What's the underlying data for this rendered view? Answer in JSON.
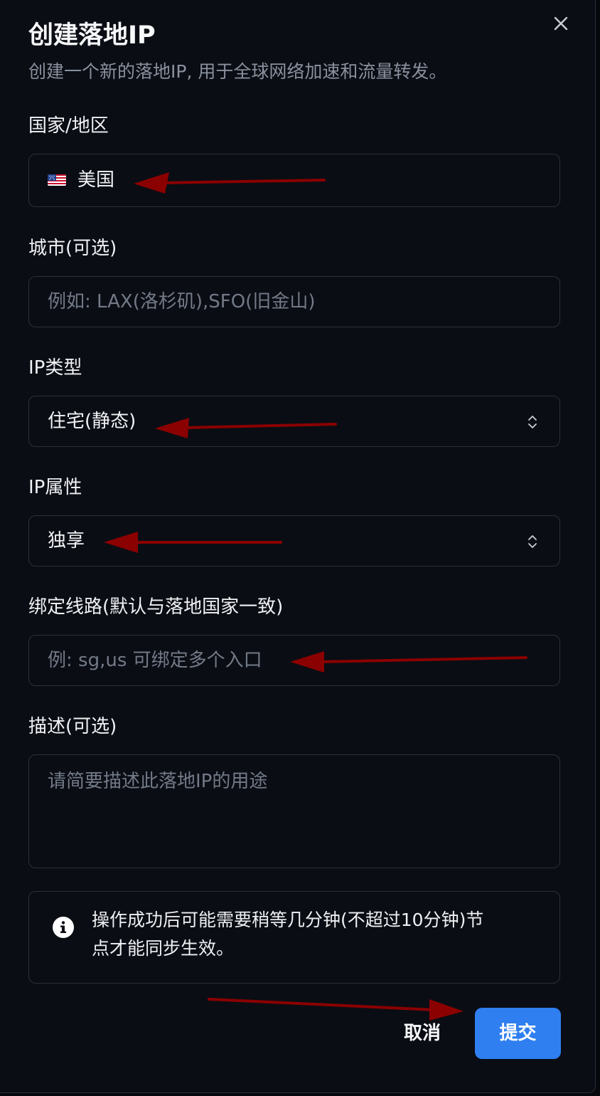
{
  "dialog": {
    "title": "创建落地IP",
    "subtitle": "创建一个新的落地IP, 用于全球网络加速和流量转发。",
    "close_icon": "close-icon"
  },
  "form": {
    "country": {
      "label": "国家/地区",
      "value": "美国",
      "flag_icon": "us-flag-icon"
    },
    "city": {
      "label": "城市(可选)",
      "value": "",
      "placeholder": "例如: LAX(洛杉矶),SFO(旧金山)"
    },
    "ip_type": {
      "label": "IP类型",
      "value": "住宅(静态)",
      "icon": "chevron-up-down-icon"
    },
    "ip_attribute": {
      "label": "IP属性",
      "value": "独享",
      "icon": "chevron-up-down-icon"
    },
    "bind_route": {
      "label": "绑定线路(默认与落地国家一致)",
      "value": "",
      "placeholder": "例: sg,us 可绑定多个入口"
    },
    "description": {
      "label": "描述(可选)",
      "value": "",
      "placeholder": "请简要描述此落地IP的用途"
    }
  },
  "notice": {
    "icon": "info-icon",
    "text_line1": "操作成功后可能需要稍等几分钟(不超过10分钟)节",
    "text_line2": "点才能同步生效。"
  },
  "actions": {
    "cancel_label": "取消",
    "submit_label": "提交"
  },
  "colors": {
    "background": "#0a0d14",
    "border": "#2b303b",
    "accent": "#2f7ff0",
    "annotation_arrow": "#8b0000"
  }
}
